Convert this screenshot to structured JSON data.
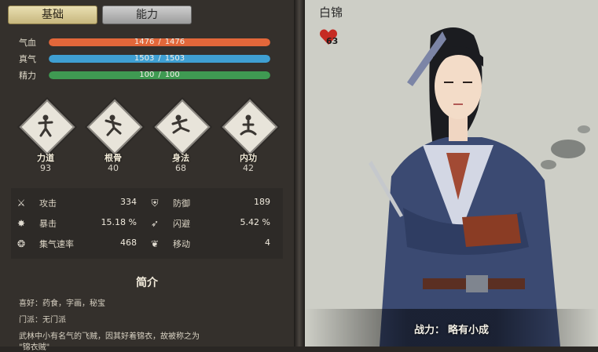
{
  "tabs": {
    "basic": "基础",
    "ability": "能力"
  },
  "bars": [
    {
      "label": "气血",
      "current": "1476",
      "max": "1476",
      "ratio": 1.0,
      "color": "#e2673a"
    },
    {
      "label": "真气",
      "current": "1503",
      "max": "1503",
      "ratio": 1.0,
      "color": "#3f9fd2"
    },
    {
      "label": "精力",
      "current": "100",
      "max": "100",
      "ratio": 1.0,
      "color": "#3f9a52"
    }
  ],
  "bar_sep": "/",
  "skills": [
    {
      "name": "力道",
      "value": "93"
    },
    {
      "name": "根骨",
      "value": "40"
    },
    {
      "name": "身法",
      "value": "68"
    },
    {
      "name": "内功",
      "value": "42"
    }
  ],
  "stats": {
    "attack": {
      "label": "攻击",
      "value": "334"
    },
    "defense": {
      "label": "防御",
      "value": "189"
    },
    "crit": {
      "label": "暴击",
      "value": "15.18 %"
    },
    "dodge": {
      "label": "闪避",
      "value": "5.42 %"
    },
    "qi_speed": {
      "label": "集气速率",
      "value": "468"
    },
    "move": {
      "label": "移动",
      "value": "4"
    }
  },
  "intro": {
    "title": "简介",
    "hobby": "喜好：药食，字画，秘宝",
    "sect": "门派：无门派",
    "desc": "武林中小有名气的飞贼，因其好着锦衣，故被称之为",
    "desc2": "\"锦衣贼\""
  },
  "character": {
    "name": "白锦",
    "favor": "63"
  },
  "power": {
    "label": "战力：",
    "value": "略有小成"
  }
}
